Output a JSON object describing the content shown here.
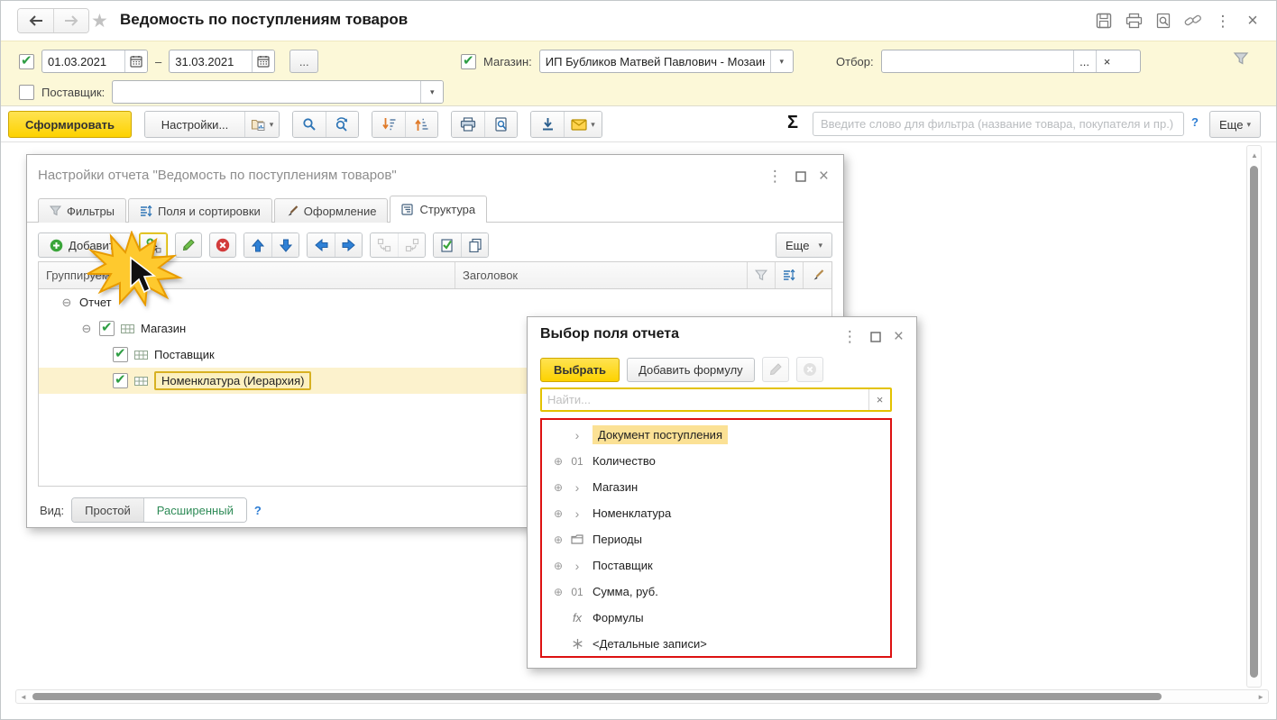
{
  "colors": {
    "panel_yellow": "#fcf8d8",
    "accent_yellow": "#fdd200",
    "selected_row": "#fcf2cd",
    "item_highlight": "#fbe195",
    "list_red_border": "#dd1111",
    "icon_blue": "#2e75b6",
    "icon_green": "#3aa53a",
    "icon_red": "#cc3333"
  },
  "window": {
    "title": "Ведомость по поступлениям товаров",
    "more_glyph": "⋮",
    "close_glyph": "×"
  },
  "filter_panel": {
    "period": {
      "checked": true,
      "from": "01.03.2021",
      "dash": "–",
      "to": "31.03.2021",
      "ellipsis": "..."
    },
    "shop": {
      "checked": true,
      "label": "Магазин:",
      "value": "ИП Бубликов Матвей Павлович - Мозаика.",
      "caret": "▾"
    },
    "selection": {
      "label": "Отбор:",
      "value": "",
      "ellipsis": "...",
      "clear": "×"
    },
    "supplier": {
      "checked": false,
      "label": "Поставщик:",
      "value": "",
      "caret": "▾"
    }
  },
  "toolbar": {
    "generate_label": "Сформировать",
    "settings_label": "Настройки...",
    "sigma": "Σ",
    "filter_placeholder": "Введите слово для фильтра (название товара, покупателя и пр.)",
    "help": "?",
    "more_label": "Еще",
    "caret": "▾"
  },
  "settings_dialog": {
    "title": "Настройки отчета \"Ведомость по поступлениям товаров\"",
    "more_glyph": "⋮",
    "close_glyph": "×",
    "tabs": [
      {
        "label": "Фильтры"
      },
      {
        "label": "Поля и сортировки"
      },
      {
        "label": "Оформление"
      },
      {
        "label": "Структура",
        "active": true
      }
    ],
    "add_label": "Добавить",
    "more_label": "Еще",
    "caret": "▾",
    "columns": {
      "col1": "Группируемые поля",
      "col2": "Заголовок"
    },
    "tree": [
      {
        "label": "Отчет",
        "checked": false
      },
      {
        "label": "Магазин",
        "checked": true
      },
      {
        "label": "Поставщик",
        "checked": true
      },
      {
        "label": "Номенклатура (Иерархия)",
        "checked": true,
        "selected": true
      }
    ],
    "expander_minus": "⊖",
    "check_glyph": "✔",
    "view": {
      "label": "Вид:",
      "simple": "Простой",
      "extended": "Расширенный",
      "help": "?"
    }
  },
  "field_dialog": {
    "title": "Выбор поля отчета",
    "more_glyph": "⋮",
    "close_glyph": "×",
    "select_label": "Выбрать",
    "add_formula_label": "Добавить формулу",
    "search_placeholder": "Найти...",
    "search_clear": "×",
    "plus_glyph": "⊕",
    "chevron_glyph": "›",
    "items": [
      {
        "label": "Документ поступления",
        "highlighted": true
      },
      {
        "prefix": "01",
        "label": "Количество"
      },
      {
        "label": "Магазин"
      },
      {
        "label": "Номенклатура"
      },
      {
        "label": "Периоды"
      },
      {
        "label": "Поставщик"
      },
      {
        "prefix": "01",
        "label": "Сумма, руб."
      },
      {
        "prefix": "fx",
        "label": "Формулы"
      },
      {
        "label": "<Детальные записи>"
      }
    ]
  }
}
